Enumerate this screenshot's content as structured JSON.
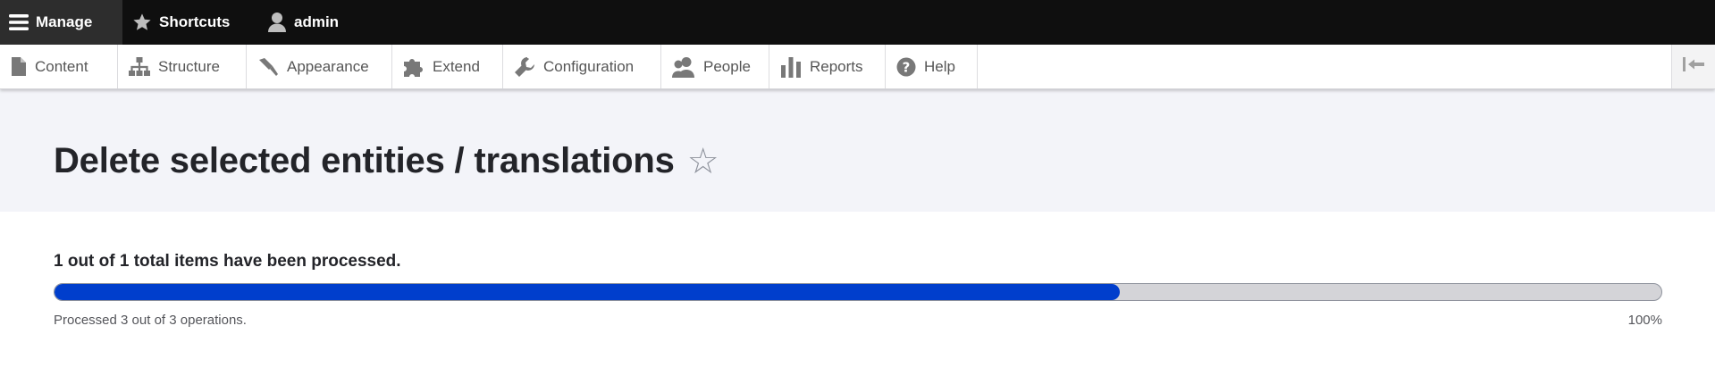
{
  "toolbar": {
    "manage_label": "Manage",
    "shortcuts_label": "Shortcuts",
    "user_label": "admin"
  },
  "tray": {
    "items": [
      {
        "label": "Content",
        "icon": "file-icon"
      },
      {
        "label": "Structure",
        "icon": "sitemap-icon"
      },
      {
        "label": "Appearance",
        "icon": "paintbrush-icon"
      },
      {
        "label": "Extend",
        "icon": "puzzle-icon"
      },
      {
        "label": "Configuration",
        "icon": "wrench-icon"
      },
      {
        "label": "People",
        "icon": "people-icon"
      },
      {
        "label": "Reports",
        "icon": "bar-chart-icon"
      },
      {
        "label": "Help",
        "icon": "help-icon"
      }
    ],
    "orientation_icon": "orientation-toggle-icon"
  },
  "page": {
    "title": "Delete selected entities / translations",
    "shortcut_star": "☆"
  },
  "progress": {
    "label": "1 out of 1 total items have been processed.",
    "fill_fraction": 0.663,
    "description": "Processed 3 out of 3 operations.",
    "percentage": "100%"
  },
  "colors": {
    "toolbar_bg": "#0f0f0f",
    "progress_fill": "#003ecc",
    "progress_track": "#d4d4d8",
    "header_bg": "#f3f4f9"
  }
}
